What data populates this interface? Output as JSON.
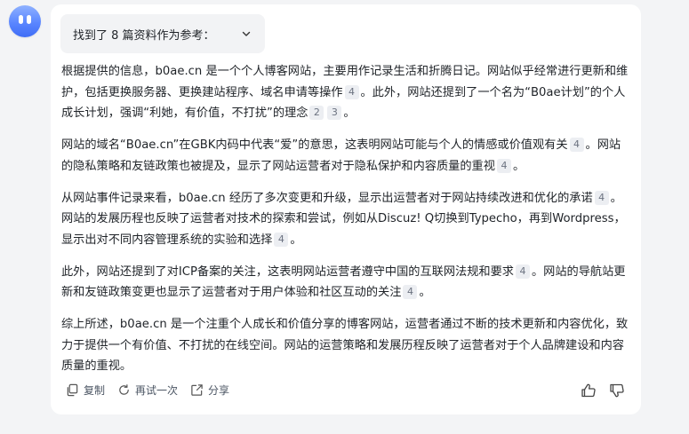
{
  "references_label": "找到了 8 篇资料作为参考：",
  "paragraphs": [
    [
      {
        "t": "根据提供的信息，b0ae.cn 是一个个人博客网站，主要用作记录生活和折腾日记。网站似乎经常进行更新和维护，包括更换服务器、更换建站程序、域名申请等操作"
      },
      {
        "c": "4"
      },
      {
        "t": "。此外，网站还提到了一个名为“B0ae计划”的个人成长计划，强调“利她，有价值，不打扰”的理念"
      },
      {
        "c": "2"
      },
      {
        "c": "3"
      },
      {
        "t": "。"
      }
    ],
    [
      {
        "t": "网站的域名“B0ae.cn”在GBK内码中代表“爱”的意思，这表明网站可能与个人的情感或价值观有关"
      },
      {
        "c": "4"
      },
      {
        "t": "。网站的隐私策略和友链政策也被提及，显示了网站运营者对于隐私保护和内容质量的重视"
      },
      {
        "c": "4"
      },
      {
        "t": "。"
      }
    ],
    [
      {
        "t": "从网站事件记录来看，b0ae.cn 经历了多次变更和升级，显示出运营者对于网站持续改进和优化的承诺"
      },
      {
        "c": "4"
      },
      {
        "t": "。网站的发展历程也反映了运营者对技术的探索和尝试，例如从Discuz! Q切换到Typecho，再到Wordpress，显示出对不同内容管理系统的实验和选择"
      },
      {
        "c": "4"
      },
      {
        "t": "。"
      }
    ],
    [
      {
        "t": "此外，网站还提到了对ICP备案的关注，这表明网站运营者遵守中国的互联网法规和要求"
      },
      {
        "c": "4"
      },
      {
        "t": "。网站的导航站更新和友链政策变更也显示了运营者对于用户体验和社区互动的关注"
      },
      {
        "c": "4"
      },
      {
        "t": "。"
      }
    ],
    [
      {
        "t": "综上所述，b0ae.cn 是一个注重个人成长和价值分享的博客网站，运营者通过不断的技术更新和内容优化，致力于提供一个有价值、不打扰的在线空间。网站的运营策略和发展历程反映了运营者对于个人品牌建设和内容质量的重视。"
      }
    ]
  ],
  "actions": {
    "copy_label": "复制",
    "retry_label": "再试一次",
    "share_label": "分享"
  },
  "icons": {
    "copy": "copy-icon",
    "retry": "retry-icon",
    "share": "share-icon",
    "like": "thumbs-up-icon",
    "dislike": "thumbs-down-icon",
    "expand": "chevron-down-icon"
  },
  "colors": {
    "page_bg": "#f3f4f6",
    "card_bg": "#ffffff",
    "refs_bg": "#f2f3f5",
    "citation_bg": "#eceef2",
    "avatar_accent": "#4f7cff"
  }
}
